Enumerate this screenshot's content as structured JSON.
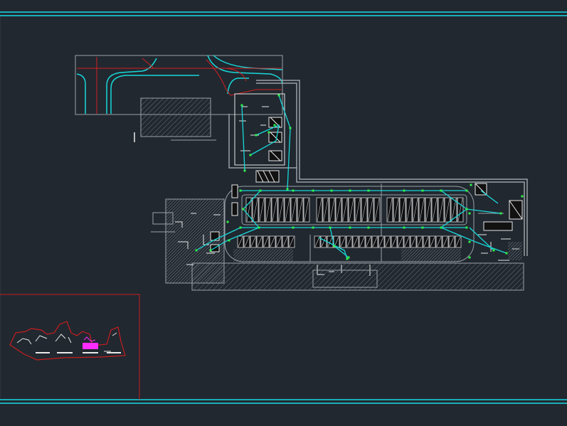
{
  "drawing": {
    "colors": {
      "background": "#212830",
      "frame": "#19d9e6",
      "wall": "#9aa0a6",
      "hatch": "#6a6f75",
      "route": "#18d8d8",
      "node": "#2ef04a",
      "red_line": "#d42020",
      "keyplan_highlight": "#ff2bff",
      "keyplan_border": "#c81e1e",
      "spaces": "#e8e8e8"
    },
    "layers": [
      {
        "id": "title-frame",
        "visible": true
      },
      {
        "id": "access-road",
        "visible": true
      },
      {
        "id": "parking-garage",
        "visible": true
      },
      {
        "id": "evacuation-routes",
        "visible": true
      },
      {
        "id": "key-plan",
        "visible": true
      }
    ]
  }
}
